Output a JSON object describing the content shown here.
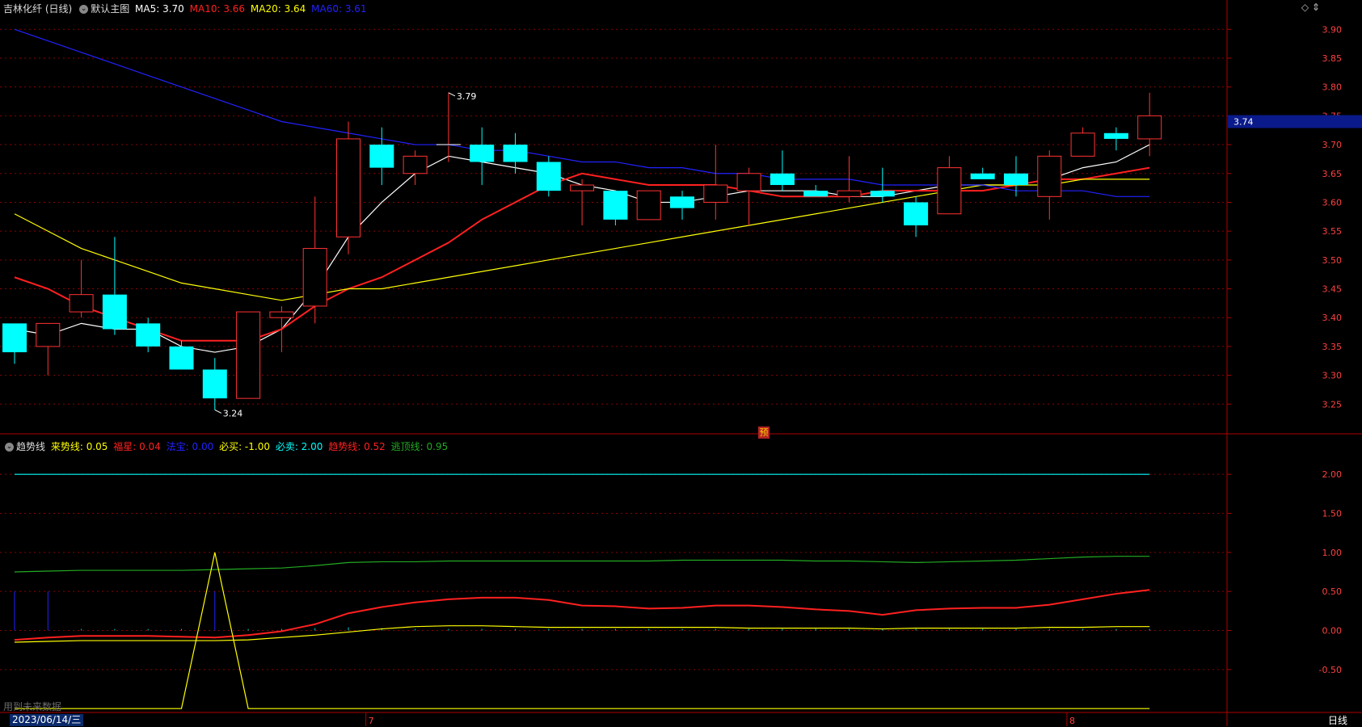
{
  "header": {
    "stock": "吉林化纤 (日线)",
    "view": "默认主图",
    "ma5": {
      "label": "MA5: 3.70",
      "color": "#ffffff"
    },
    "ma10": {
      "label": "MA10: 3.66",
      "color": "#ff2020"
    },
    "ma20": {
      "label": "MA20: 3.64",
      "color": "#ffff00"
    },
    "ma60": {
      "label": "MA60: 3.61",
      "color": "#2222ff"
    }
  },
  "sub_header": {
    "name": "趋势线",
    "items": [
      {
        "label": "来势线: 0.05",
        "color": "#ffff00"
      },
      {
        "label": "福星: 0.04",
        "color": "#ff2020"
      },
      {
        "label": "法宝: 0.00",
        "color": "#2222ff"
      },
      {
        "label": "必买: -1.00",
        "color": "#ffff00"
      },
      {
        "label": "必卖: 2.00",
        "color": "#00ffff"
      },
      {
        "label": "趋势线: 0.52",
        "color": "#ff2020"
      },
      {
        "label": "逃顶线: 0.95",
        "color": "#22aa22"
      }
    ]
  },
  "corner": "◇ ⇕",
  "date_label": "2023/06/14/三",
  "future_note": "用到未来数据",
  "period": "日线",
  "yu_badge": "预",
  "colors": {
    "up": "#ff3232",
    "down": "#00ffff",
    "grid": "#8b0000",
    "axis_text": "#ff4040"
  },
  "chart_data": [
    {
      "type": "candlestick",
      "title": "吉林化纤 (日线)",
      "ylim": [
        3.2,
        3.92
      ],
      "y_ticks": [
        3.25,
        3.3,
        3.35,
        3.4,
        3.45,
        3.5,
        3.55,
        3.6,
        3.65,
        3.7,
        3.75,
        3.8,
        3.85,
        3.9
      ],
      "current_price_label": "3.74",
      "high_annotation": "3.79",
      "low_annotation": "3.24",
      "x_month_marks": [
        {
          "index": 11,
          "label": "7"
        },
        {
          "index": 32,
          "label": "8"
        }
      ],
      "candles": [
        {
          "o": 3.39,
          "h": 3.39,
          "l": 3.32,
          "c": 3.34
        },
        {
          "o": 3.35,
          "h": 3.39,
          "l": 3.3,
          "c": 3.39
        },
        {
          "o": 3.41,
          "h": 3.5,
          "l": 3.4,
          "c": 3.44
        },
        {
          "o": 3.44,
          "h": 3.54,
          "l": 3.37,
          "c": 3.38
        },
        {
          "o": 3.39,
          "h": 3.4,
          "l": 3.34,
          "c": 3.35
        },
        {
          "o": 3.35,
          "h": 3.36,
          "l": 3.31,
          "c": 3.31
        },
        {
          "o": 3.31,
          "h": 3.33,
          "l": 3.24,
          "c": 3.26
        },
        {
          "o": 3.26,
          "h": 3.41,
          "l": 3.26,
          "c": 3.41
        },
        {
          "o": 3.4,
          "h": 3.42,
          "l": 3.34,
          "c": 3.41
        },
        {
          "o": 3.42,
          "h": 3.61,
          "l": 3.39,
          "c": 3.52
        },
        {
          "o": 3.54,
          "h": 3.74,
          "l": 3.51,
          "c": 3.71
        },
        {
          "o": 3.7,
          "h": 3.73,
          "l": 3.63,
          "c": 3.66
        },
        {
          "o": 3.65,
          "h": 3.69,
          "l": 3.63,
          "c": 3.68
        },
        {
          "o": 3.7,
          "h": 3.79,
          "l": 3.67,
          "c": 3.7
        },
        {
          "o": 3.7,
          "h": 3.73,
          "l": 3.63,
          "c": 3.67
        },
        {
          "o": 3.7,
          "h": 3.72,
          "l": 3.65,
          "c": 3.67
        },
        {
          "o": 3.67,
          "h": 3.68,
          "l": 3.61,
          "c": 3.62
        },
        {
          "o": 3.62,
          "h": 3.64,
          "l": 3.56,
          "c": 3.63
        },
        {
          "o": 3.62,
          "h": 3.62,
          "l": 3.56,
          "c": 3.57
        },
        {
          "o": 3.57,
          "h": 3.62,
          "l": 3.57,
          "c": 3.62
        },
        {
          "o": 3.61,
          "h": 3.62,
          "l": 3.57,
          "c": 3.59
        },
        {
          "o": 3.6,
          "h": 3.7,
          "l": 3.57,
          "c": 3.63
        },
        {
          "o": 3.62,
          "h": 3.66,
          "l": 3.56,
          "c": 3.65
        },
        {
          "o": 3.65,
          "h": 3.69,
          "l": 3.62,
          "c": 3.63
        },
        {
          "o": 3.62,
          "h": 3.63,
          "l": 3.61,
          "c": 3.61
        },
        {
          "o": 3.61,
          "h": 3.68,
          "l": 3.6,
          "c": 3.62
        },
        {
          "o": 3.62,
          "h": 3.66,
          "l": 3.6,
          "c": 3.61
        },
        {
          "o": 3.6,
          "h": 3.61,
          "l": 3.54,
          "c": 3.56
        },
        {
          "o": 3.58,
          "h": 3.68,
          "l": 3.58,
          "c": 3.66
        },
        {
          "o": 3.65,
          "h": 3.66,
          "l": 3.64,
          "c": 3.64
        },
        {
          "o": 3.65,
          "h": 3.68,
          "l": 3.61,
          "c": 3.63
        },
        {
          "o": 3.61,
          "h": 3.69,
          "l": 3.57,
          "c": 3.68
        },
        {
          "o": 3.68,
          "h": 3.73,
          "l": 3.68,
          "c": 3.72
        },
        {
          "o": 3.72,
          "h": 3.73,
          "l": 3.69,
          "c": 3.71
        },
        {
          "o": 3.71,
          "h": 3.79,
          "l": 3.68,
          "c": 3.75
        }
      ],
      "series": [
        {
          "name": "MA5",
          "color": "#ffffff",
          "values": [
            3.38,
            3.37,
            3.39,
            3.38,
            3.38,
            3.35,
            3.34,
            3.35,
            3.38,
            3.45,
            3.54,
            3.6,
            3.65,
            3.68,
            3.67,
            3.66,
            3.65,
            3.63,
            3.62,
            3.6,
            3.6,
            3.61,
            3.62,
            3.62,
            3.62,
            3.61,
            3.61,
            3.62,
            3.63,
            3.63,
            3.63,
            3.64,
            3.66,
            3.67,
            3.7
          ]
        },
        {
          "name": "MA10",
          "color": "#ff2020",
          "values": [
            3.47,
            3.45,
            3.42,
            3.4,
            3.38,
            3.36,
            3.36,
            3.36,
            3.38,
            3.42,
            3.45,
            3.47,
            3.5,
            3.53,
            3.57,
            3.6,
            3.63,
            3.65,
            3.64,
            3.63,
            3.63,
            3.63,
            3.62,
            3.61,
            3.61,
            3.61,
            3.62,
            3.62,
            3.62,
            3.62,
            3.63,
            3.64,
            3.64,
            3.65,
            3.66
          ]
        },
        {
          "name": "MA20",
          "color": "#ffff00",
          "values": [
            3.58,
            3.55,
            3.52,
            3.5,
            3.48,
            3.46,
            3.45,
            3.44,
            3.43,
            3.44,
            3.45,
            3.45,
            3.46,
            3.47,
            3.48,
            3.49,
            3.5,
            3.51,
            3.52,
            3.53,
            3.54,
            3.55,
            3.56,
            3.57,
            3.58,
            3.59,
            3.6,
            3.61,
            3.62,
            3.63,
            3.63,
            3.63,
            3.64,
            3.64,
            3.64
          ]
        },
        {
          "name": "MA60",
          "color": "#2222ff",
          "values": [
            3.9,
            3.88,
            3.86,
            3.84,
            3.82,
            3.8,
            3.78,
            3.76,
            3.74,
            3.73,
            3.72,
            3.71,
            3.7,
            3.7,
            3.69,
            3.69,
            3.68,
            3.67,
            3.67,
            3.66,
            3.66,
            3.65,
            3.65,
            3.64,
            3.64,
            3.64,
            3.63,
            3.63,
            3.63,
            3.63,
            3.62,
            3.62,
            3.62,
            3.61,
            3.61
          ]
        }
      ]
    },
    {
      "type": "line",
      "title": "趋势线",
      "ylim": [
        -1.05,
        2.25
      ],
      "y_ticks": [
        -0.5,
        0.0,
        0.5,
        1.0,
        1.5,
        2.0
      ],
      "series": [
        {
          "name": "必卖",
          "color": "#00ffff",
          "values": [
            2,
            2,
            2,
            2,
            2,
            2,
            2,
            2,
            2,
            2,
            2,
            2,
            2,
            2,
            2,
            2,
            2,
            2,
            2,
            2,
            2,
            2,
            2,
            2,
            2,
            2,
            2,
            2,
            2,
            2,
            2,
            2,
            2,
            2,
            2
          ]
        },
        {
          "name": "逃顶线",
          "color": "#22aa22",
          "values": [
            0.75,
            0.76,
            0.77,
            0.77,
            0.77,
            0.77,
            0.78,
            0.79,
            0.8,
            0.83,
            0.87,
            0.88,
            0.88,
            0.89,
            0.89,
            0.89,
            0.89,
            0.89,
            0.89,
            0.89,
            0.9,
            0.9,
            0.9,
            0.9,
            0.89,
            0.89,
            0.88,
            0.87,
            0.88,
            0.89,
            0.9,
            0.92,
            0.94,
            0.95,
            0.95
          ]
        },
        {
          "name": "趋势线",
          "color": "#ff2020",
          "values": [
            -0.12,
            -0.09,
            -0.07,
            -0.07,
            -0.07,
            -0.08,
            -0.09,
            -0.06,
            -0.01,
            0.08,
            0.22,
            0.3,
            0.36,
            0.4,
            0.42,
            0.42,
            0.39,
            0.32,
            0.31,
            0.28,
            0.29,
            0.32,
            0.32,
            0.3,
            0.27,
            0.25,
            0.2,
            0.26,
            0.28,
            0.29,
            0.29,
            0.33,
            0.4,
            0.47,
            0.52
          ]
        },
        {
          "name": "来势线",
          "color": "#ffff00",
          "values": [
            -0.15,
            -0.14,
            -0.13,
            -0.13,
            -0.13,
            -0.13,
            -0.13,
            -0.12,
            -0.09,
            -0.06,
            -0.02,
            0.02,
            0.05,
            0.06,
            0.06,
            0.05,
            0.04,
            0.04,
            0.04,
            0.04,
            0.04,
            0.04,
            0.03,
            0.03,
            0.03,
            0.03,
            0.02,
            0.03,
            0.03,
            0.03,
            0.03,
            0.04,
            0.04,
            0.05,
            0.05
          ]
        },
        {
          "name": "必买",
          "color": "#ffff00",
          "values": [
            -1,
            -1,
            -1,
            -1,
            -1,
            -1,
            1,
            -1,
            -1,
            -1,
            -1,
            -1,
            -1,
            -1,
            -1,
            -1,
            -1,
            -1,
            -1,
            -1,
            -1,
            -1,
            -1,
            -1,
            -1,
            -1,
            -1,
            -1,
            -1,
            -1,
            -1,
            -1,
            -1,
            -1,
            -1
          ]
        }
      ],
      "bars": [
        0.5,
        0.5,
        0.02,
        0.02,
        0.02,
        0.02,
        0.5,
        0.02,
        0.02,
        0.03,
        0.04,
        0.03,
        0.02,
        0.02,
        0.02,
        0.02,
        0.02,
        0.02,
        0.02,
        0.02,
        0.02,
        0.02,
        0.02,
        0.02,
        0.02,
        0.02,
        0.02,
        0.02,
        0.02,
        0.02,
        0.02,
        0.02,
        0.02,
        0.02,
        0.02
      ]
    }
  ]
}
